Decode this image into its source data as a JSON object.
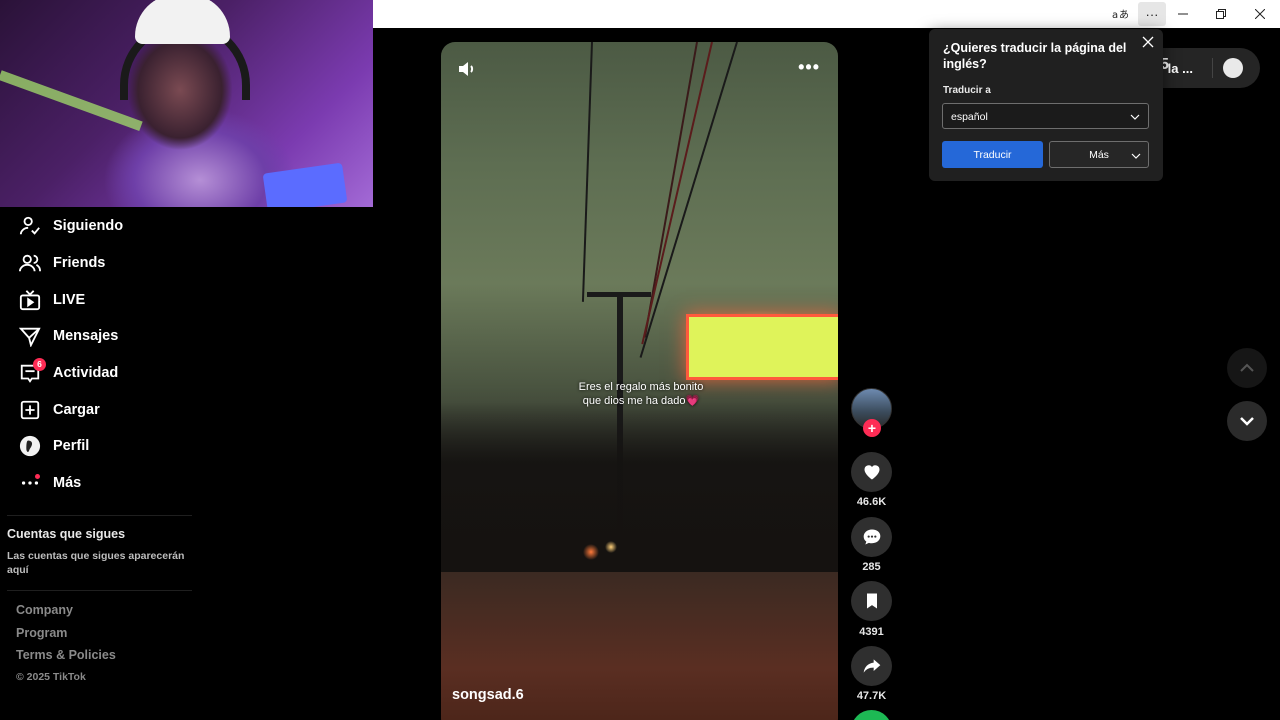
{
  "browser": {
    "translate_icon": "translate-icon",
    "more_label": "···",
    "minimize_icon": "minimize-icon",
    "restore_icon": "restore-icon",
    "close_icon": "close-icon"
  },
  "sidebar": {
    "items": [
      {
        "label": "Siguiendo",
        "icon": "following-icon"
      },
      {
        "label": "Friends",
        "icon": "friends-icon"
      },
      {
        "label": "LIVE",
        "icon": "live-icon"
      },
      {
        "label": "Mensajes",
        "icon": "messages-icon"
      },
      {
        "label": "Actividad",
        "icon": "activity-icon",
        "badge": "6"
      },
      {
        "label": "Cargar",
        "icon": "upload-icon"
      },
      {
        "label": "Perfil",
        "icon": "profile-icon"
      },
      {
        "label": "Más",
        "icon": "more-icon"
      }
    ],
    "following_title": "Cuentas que sigues",
    "following_empty": "Las cuentas que sigues aparecerán aquí",
    "footer": {
      "company": "Company",
      "program": "Program",
      "terms": "Terms & Policies",
      "copyright": "© 2025 TikTok"
    }
  },
  "video": {
    "caption_line1": "Eres el regalo más bonito",
    "caption_line2": "que dios me ha dado💗",
    "author": "songsad.6",
    "more_label": "•••"
  },
  "actions": {
    "likes": "46.6K",
    "comments": "285",
    "saves": "4391",
    "shares": "47.7K",
    "follow_label": "+"
  },
  "top_pill": {
    "number": "5",
    "text": "r la ..."
  },
  "translate_popup": {
    "title": "¿Quieres traducir la página del inglés?",
    "label": "Traducir a",
    "selected_language": "español",
    "translate_button": "Traducir",
    "more_button": "Más"
  },
  "colors": {
    "accent": "#fe2c55",
    "translate_button": "#2568d8",
    "background": "#000000"
  }
}
